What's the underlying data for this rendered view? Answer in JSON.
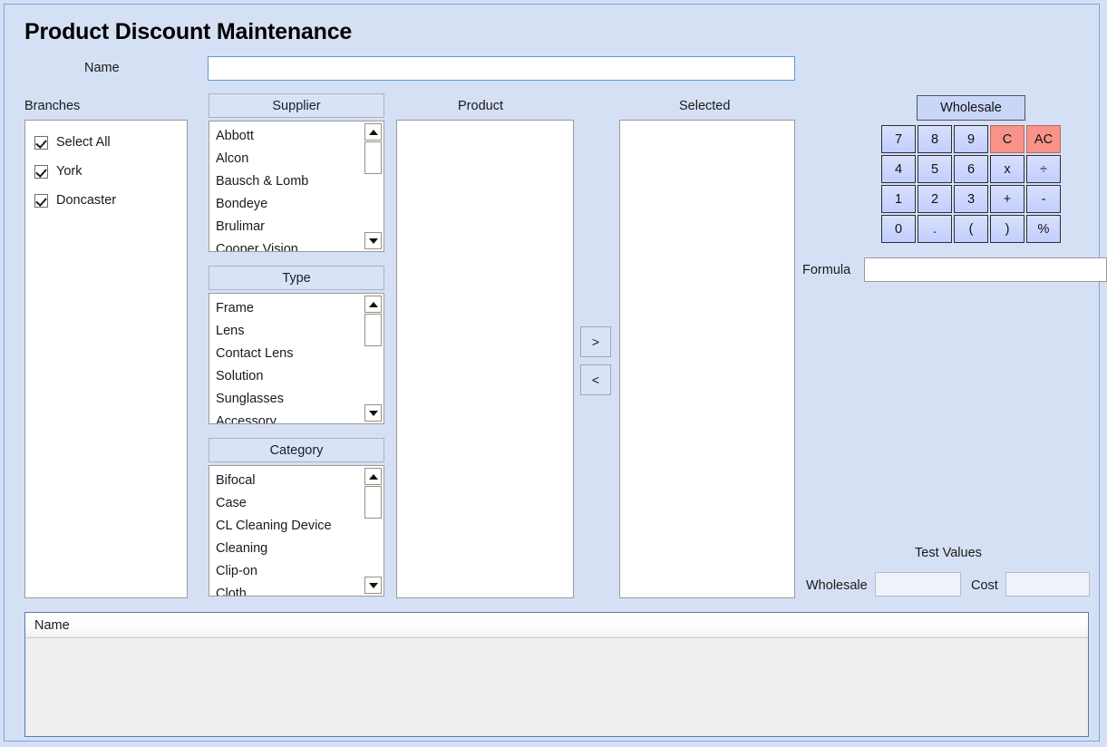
{
  "window": {
    "title": "Product Discount Maintenance"
  },
  "form": {
    "name_label": "Name",
    "name_value": "",
    "name_placeholder": ""
  },
  "branches": {
    "caption": "Branches",
    "items": [
      {
        "label": "Select All",
        "checked": true
      },
      {
        "label": "York",
        "checked": true
      },
      {
        "label": "Doncaster",
        "checked": true
      }
    ]
  },
  "supplier": {
    "header": "Supplier",
    "items": [
      "Abbott",
      "Alcon",
      "Bausch & Lomb",
      "Bondeye",
      "Brulimar",
      "Cooper Vision"
    ]
  },
  "type": {
    "header": "Type",
    "items": [
      "Frame",
      "Lens",
      "Contact Lens",
      "Solution",
      "Sunglasses",
      "Accessory"
    ]
  },
  "category": {
    "header": "Category",
    "items": [
      "Bifocal",
      "Case",
      "CL Cleaning Device",
      "Cleaning",
      "Clip-on",
      "Cloth"
    ]
  },
  "product": {
    "caption": "Product",
    "items": []
  },
  "selected": {
    "caption": "Selected",
    "items": []
  },
  "transfer": {
    "add_label": ">",
    "remove_label": "<"
  },
  "calculator": {
    "mode_label": "Wholesale",
    "keys": [
      {
        "label": "7",
        "kind": "digit"
      },
      {
        "label": "8",
        "kind": "digit"
      },
      {
        "label": "9",
        "kind": "digit"
      },
      {
        "label": "C",
        "kind": "danger"
      },
      {
        "label": "AC",
        "kind": "danger"
      },
      {
        "label": "4",
        "kind": "digit"
      },
      {
        "label": "5",
        "kind": "digit"
      },
      {
        "label": "6",
        "kind": "digit"
      },
      {
        "label": "x",
        "kind": "op"
      },
      {
        "label": "÷",
        "kind": "op"
      },
      {
        "label": "1",
        "kind": "digit"
      },
      {
        "label": "2",
        "kind": "digit"
      },
      {
        "label": "3",
        "kind": "digit"
      },
      {
        "label": "+",
        "kind": "op"
      },
      {
        "label": "-",
        "kind": "op"
      },
      {
        "label": "0",
        "kind": "digit"
      },
      {
        "label": ".",
        "kind": "op"
      },
      {
        "label": "(",
        "kind": "op"
      },
      {
        "label": ")",
        "kind": "op"
      },
      {
        "label": "%",
        "kind": "op"
      }
    ]
  },
  "formula": {
    "label": "Formula",
    "value": "",
    "placeholder": ""
  },
  "test_values": {
    "caption": "Test Values",
    "wholesale_label": "Wholesale",
    "wholesale_value": "",
    "cost_label": "Cost",
    "cost_value": ""
  },
  "results_grid": {
    "columns": [
      "Name"
    ],
    "rows": []
  },
  "colors": {
    "background": "#d6e0f5",
    "frame_border": "#7ba2dd",
    "focus_border": "#5b9bd5",
    "key_fill": "#c7d3fb",
    "key_danger": "#f79389",
    "grid_body": "#efefef"
  }
}
